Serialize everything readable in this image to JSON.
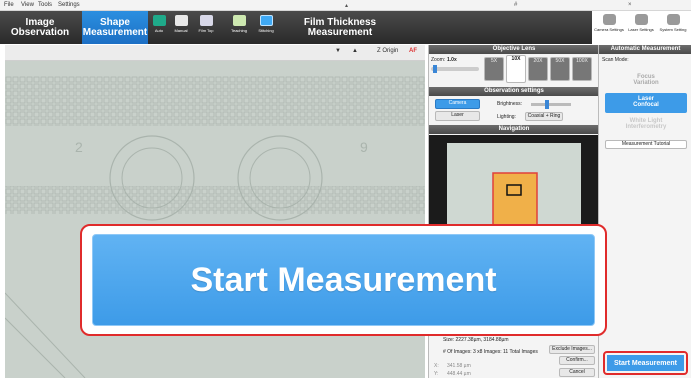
{
  "menu": {
    "file": "File",
    "view": "View",
    "tools": "Tools",
    "settings": "Settings"
  },
  "tabs": [
    {
      "line1": "Image",
      "line2": "Observation"
    },
    {
      "line1": "Shape",
      "line2": "Measurement"
    },
    {
      "line1": "Film Thickness",
      "line2": "Measurement"
    }
  ],
  "subtabs": [
    "Auto",
    "Manual",
    "Film Top",
    "Teaching",
    "Stitching"
  ],
  "rtools": [
    "Camera Settings",
    "Laser Settings",
    "System Setting"
  ],
  "viewer": {
    "zorigin": "Z Origin",
    "af": "AF",
    "numbers": [
      "2",
      "9"
    ]
  },
  "objective": {
    "title": "Objective Lens",
    "zoom_label": "Zoom:",
    "zoom_value": "1.0x",
    "lenses": [
      "5X",
      "10X",
      "20X",
      "50X",
      "100X"
    ],
    "selected_sub": "NA 0.30"
  },
  "obs": {
    "title": "Observation settings",
    "camera": "Camera",
    "laser": "Laser",
    "brightness": "Brightness:",
    "lighting": "Lighting:",
    "lighting_value": "Coaxial + Ring"
  },
  "nav": {
    "title": "Navigation"
  },
  "info": {
    "size": "Size: 2227.38µm, 3184.88µm",
    "images": "# Of Images: 3 x8 Images: 11 Total Images",
    "exclude": "Exclude Images...",
    "confirm": "Confirm...",
    "cancel": "Cancel",
    "x_label": "X:",
    "x_value": "341.58 µm",
    "y_label": "Y:",
    "y_value": "448.44 µm"
  },
  "auto": {
    "title": "Automatic Measurement",
    "scan_mode": "Scan Mode:",
    "modes": [
      [
        "Focus",
        "Variation"
      ],
      [
        "Laser",
        "Confocal"
      ],
      [
        "White Light",
        "Interferometry"
      ]
    ],
    "tutorial": "Measurement Tutorial"
  },
  "start_big": "Start Measurement",
  "start_small": "Start Measurement"
}
